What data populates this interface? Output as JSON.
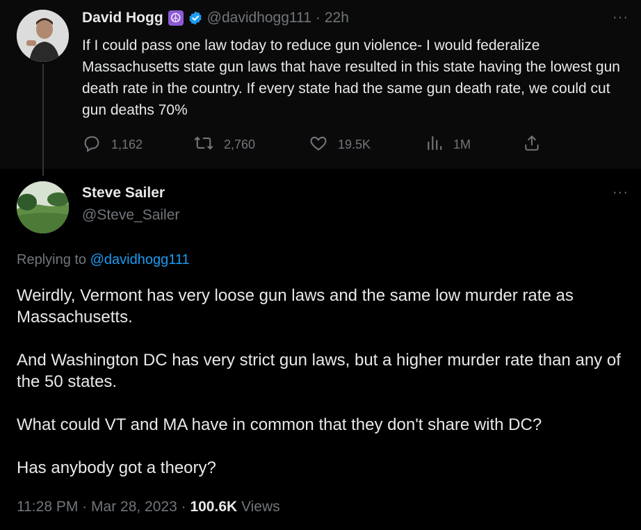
{
  "parent_tweet": {
    "name": "David Hogg",
    "emoji": "☮",
    "handle": "@davidhogg111",
    "separator": "·",
    "time": "22h",
    "more": "···",
    "text": "If I could pass one law today to reduce gun violence- I would federalize Massachusetts state gun laws that have resulted in this state having the lowest gun death rate in the country. If every state had the same gun death rate, we could cut gun deaths 70%",
    "replies": "1,162",
    "retweets": "2,760",
    "likes": "19.5K",
    "views": "1M"
  },
  "reply_tweet": {
    "name": "Steve Sailer",
    "handle": "@Steve_Sailer",
    "more": "···",
    "replying_prefix": "Replying to",
    "replying_handle": "@davidhogg111",
    "paragraphs": [
      "Weirdly, Vermont has very loose gun laws and the same low murder rate as Massachusetts.",
      "And Washington DC has very strict gun laws, but a higher murder rate than any of the 50 states.",
      "What could VT and MA have in common that they don't share with DC?",
      "Has anybody got a theory?"
    ],
    "time": "11:28 PM",
    "sep1": "·",
    "date": "Mar 28, 2023",
    "sep2": "·",
    "views_count": "100.6K",
    "views_label": "Views"
  },
  "colors": {
    "accent": "#1d9bf0",
    "muted": "#71767b",
    "text": "#e7e9ea",
    "emoji_bg": "#8e5bd6"
  },
  "icons": [
    "verified-badge-icon",
    "reply-icon",
    "retweet-icon",
    "like-icon",
    "views-icon",
    "share-icon",
    "more-icon"
  ]
}
